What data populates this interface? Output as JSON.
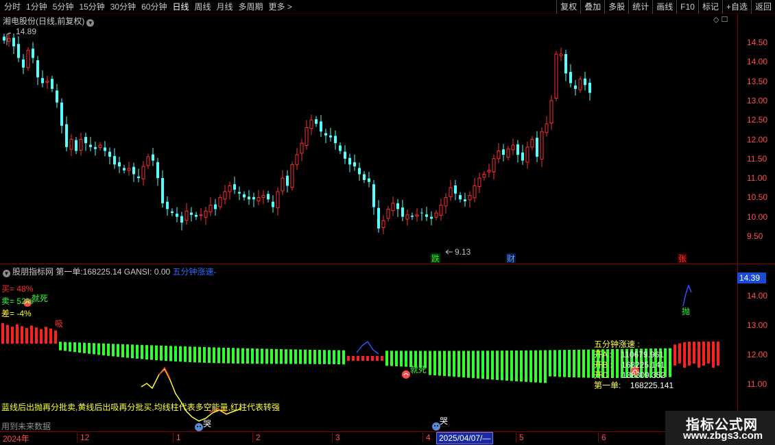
{
  "toolbar": {
    "periods": [
      {
        "label": "分时",
        "active": false
      },
      {
        "label": "1分钟",
        "active": false
      },
      {
        "label": "5分钟",
        "active": false
      },
      {
        "label": "15分钟",
        "active": false
      },
      {
        "label": "30分钟",
        "active": false
      },
      {
        "label": "60分钟",
        "active": false
      },
      {
        "label": "日线",
        "active": true
      },
      {
        "label": "周线",
        "active": false
      },
      {
        "label": "月线",
        "active": false
      },
      {
        "label": "多周期",
        "active": false
      },
      {
        "label": "更多 >",
        "active": false
      }
    ],
    "tools": [
      "复权",
      "叠加",
      "多股",
      "统计",
      "画线",
      "F10",
      "标记",
      "+自选",
      "返回"
    ]
  },
  "main_chart": {
    "title": "湘电股份(日线,前复权)",
    "high_label": "14.89",
    "low_label": "9.13",
    "markers": [
      {
        "text": "跌",
        "color": "#30e030"
      },
      {
        "text": "财",
        "color": "#60a0ff"
      },
      {
        "text": "张",
        "color": "#ff3030"
      }
    ],
    "price_ticks": [
      "14.50",
      "14.00",
      "13.50",
      "13.00",
      "12.50",
      "12.00",
      "11.50",
      "11.00",
      "10.50",
      "10.00",
      "9.50"
    ]
  },
  "indicator": {
    "name": "股朋指标网",
    "first_single_label": "第一单:",
    "first_single_value": "168225.14",
    "gansi_label": "GANSI:",
    "gansi_value": "0.00",
    "speed_label": "五分钟涨速-",
    "buy": "买= 48%",
    "sell": "卖= 52%",
    "diff": "差= -4%",
    "axis_tag": "14.39",
    "axis_ticks": [
      "14.00",
      "13.00",
      "12.00",
      "11.00"
    ],
    "signals": {
      "dead": "就死",
      "absorb": "吸",
      "throw": "抛",
      "cry": "哭"
    },
    "info": {
      "title": "五分钟涨速 :",
      "rows": [
        {
          "label": "开A :",
          "value": "110679.961"
        },
        {
          "label": "开B :",
          "value": "168225.141"
        },
        {
          "label": "开C :",
          "value": "138309.352"
        },
        {
          "label": "第一单:",
          "value": "168225.141"
        }
      ]
    },
    "legend_note": "蓝线后出抛再分批卖,黄线后出吸再分批买,均线柱代表多空能量,红柱代表转强",
    "future_note": "用到未来数据"
  },
  "time_axis": {
    "labels": [
      "2024年",
      "12",
      "1",
      "2",
      "3",
      "4",
      "5",
      "6"
    ],
    "cursor_date": "2025/04/07/—"
  },
  "watermark": {
    "title": "指标公式网",
    "url": "www.zbgs3.com"
  },
  "colors": {
    "up": "#ff3030",
    "down": "#54ffff",
    "green_bar": "#30ff30",
    "red_bar": "#ff2020",
    "axis": "#8b0000"
  }
}
